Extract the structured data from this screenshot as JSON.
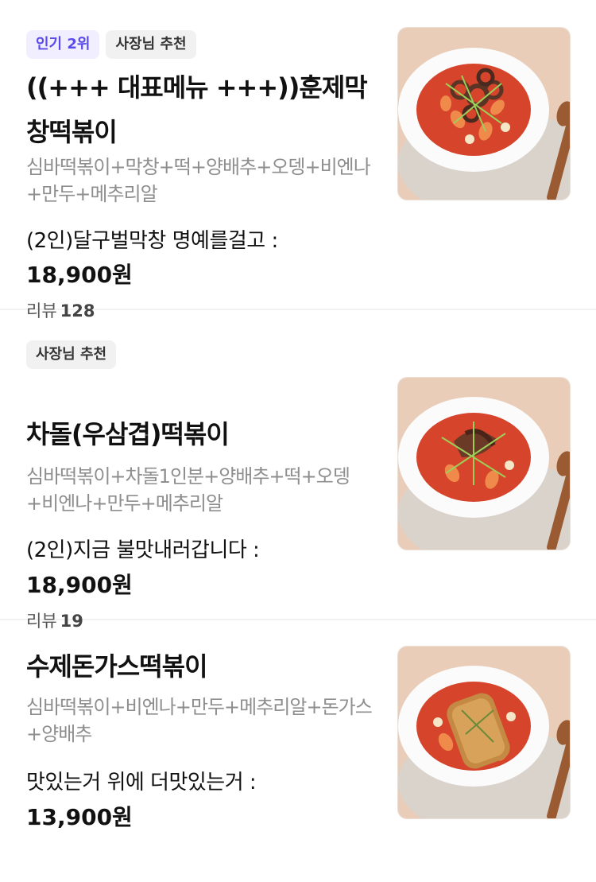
{
  "items": [
    {
      "badges": [
        "인기 2위",
        "사장님 추천"
      ],
      "name": "((+++ 대표메뉴 +++))훈제막창떡볶이",
      "description": "심바떡볶이+막창+떡+양배추+오뎅+비엔나+만두+메추리알",
      "option": "(2인)달구벌막창 명예를걸고 :",
      "price": "18,900원",
      "review_label": "리뷰",
      "review_count": "128",
      "image_icon": "tteokbokki-makchang-photo"
    },
    {
      "badges": [
        "사장님 추천"
      ],
      "name": "차돌(우삼겹)떡볶이",
      "description": "심바떡볶이+차돌1인분+양배추+떡+오뎅+비엔나+만두+메추리알",
      "option": "(2인)지금 불맛내러갑니다 :",
      "price": "18,900원",
      "review_label": "리뷰",
      "review_count": "19",
      "image_icon": "tteokbokki-chadol-photo"
    },
    {
      "badges": [],
      "name": "수제돈가스떡볶이",
      "description": "심바떡볶이+비엔나+만두+메추리알+돈가스+양배추",
      "option": "맛있는거 위에 더맛있는거 :",
      "price": "13,900원",
      "image_icon": "tteokbokki-donkatsu-photo"
    }
  ],
  "colors": {
    "popular_badge_bg": "#f1efff",
    "popular_badge_text": "#5a4ae8",
    "owner_badge_bg": "#f1f1f1",
    "sauce": "#d6452b",
    "photo_background": "#e9cdb8"
  }
}
